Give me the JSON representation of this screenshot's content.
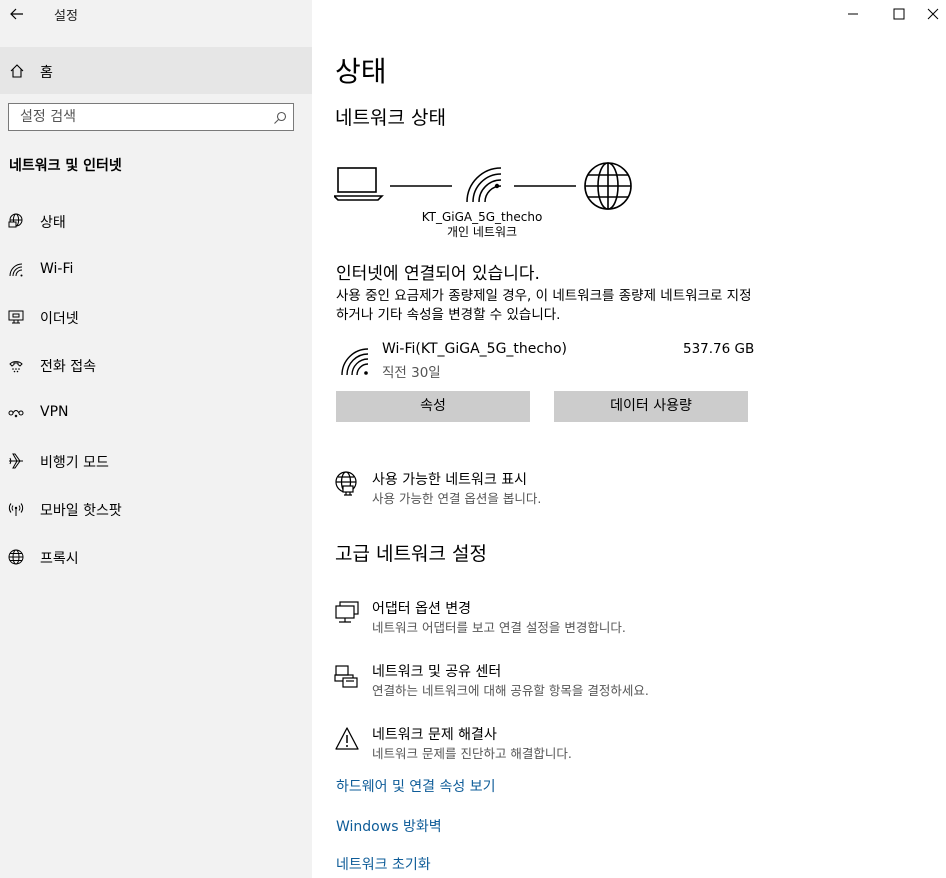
{
  "window": {
    "title": "설정"
  },
  "sidebar": {
    "home_label": "홈",
    "search_placeholder": "설정 검색",
    "section_title": "네트워크 및 인터넷",
    "items": [
      {
        "label": "상태",
        "icon": "globe-monitor-icon"
      },
      {
        "label": "Wi-Fi",
        "icon": "wifi-icon"
      },
      {
        "label": "이더넷",
        "icon": "ethernet-icon"
      },
      {
        "label": "전화 접속",
        "icon": "dial-up-icon"
      },
      {
        "label": "VPN",
        "icon": "vpn-icon"
      },
      {
        "label": "비행기 모드",
        "icon": "airplane-icon"
      },
      {
        "label": "모바일 핫스팟",
        "icon": "hotspot-icon"
      },
      {
        "label": "프록시",
        "icon": "globe-icon"
      }
    ]
  },
  "main": {
    "title": "상태",
    "network_status_heading": "네트워크 상태",
    "network_name": "KT_GiGA_5G_thecho",
    "network_profile": "개인 네트워크",
    "connected_heading": "인터넷에 연결되어 있습니다.",
    "connected_desc": "사용 중인 요금제가 종량제일 경우, 이 네트워크를 종량제 네트워크로 지정하거나 기타 속성을 변경할 수 있습니다.",
    "connection": {
      "name": "Wi-Fi(KT_GiGA_5G_thecho)",
      "time": "직전 30일",
      "usage": "537.76 GB"
    },
    "buttons": {
      "properties": "속성",
      "data_usage": "데이터 사용량"
    },
    "show_networks": {
      "title": "사용 가능한 네트워크 표시",
      "desc": "사용 가능한 연결 옵션을 봅니다."
    },
    "advanced_heading": "고급 네트워크 설정",
    "advanced_options": [
      {
        "title": "어댑터 옵션 변경",
        "desc": "네트워크 어댑터를 보고 연결 설정을 변경합니다."
      },
      {
        "title": "네트워크 및 공유 센터",
        "desc": "연결하는 네트워크에 대해 공유할 항목을 결정하세요."
      },
      {
        "title": "네트워크 문제 해결사",
        "desc": "네트워크 문제를 진단하고 해결합니다."
      }
    ],
    "links": [
      "하드웨어 및 연결 속성 보기",
      "Windows 방화벽",
      "네트워크 초기화"
    ]
  },
  "colors": {
    "accent_link": "#0e5c98",
    "sidebar_bg": "#f2f2f2",
    "button_bg": "#cccccc"
  }
}
